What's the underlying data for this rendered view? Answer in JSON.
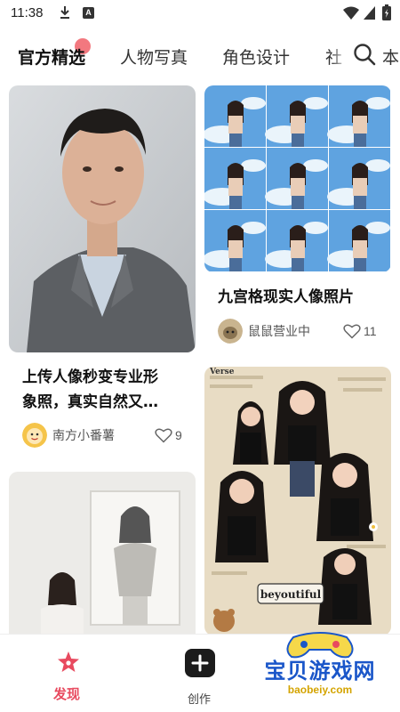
{
  "status_bar": {
    "time": "11:38",
    "icons": [
      "download-icon",
      "a-badge-icon",
      "wifi-icon",
      "cellular-icon",
      "battery-icon"
    ]
  },
  "tabs": [
    {
      "label": "官方精选",
      "active": true
    },
    {
      "label": "人物写真",
      "active": false
    },
    {
      "label": "角色设计",
      "active": false
    },
    {
      "label": "社",
      "active": false
    },
    {
      "label": "本",
      "active": false
    }
  ],
  "feed": {
    "cards": [
      {
        "title": "上传人像秒变专业形象照，真实自然又…",
        "title_line1": "上传人像秒变专业形",
        "title_line2": "象照，真实自然又…",
        "author": "南方小番薯",
        "likes": "9"
      },
      {
        "title": "九宫格现实人像照片",
        "author": "鼠鼠营业中",
        "likes": "11"
      },
      {
        "title": "",
        "author": "",
        "likes": ""
      },
      {
        "title": "",
        "author": "",
        "likes": ""
      }
    ],
    "collage_stickers": [
      "beyoutiful",
      "Verse"
    ]
  },
  "bottom_nav": {
    "discover_label": "发现",
    "create_label": "创作"
  },
  "watermark": {
    "text": "宝贝游戏网",
    "url": "baobeiy.com"
  },
  "colors": {
    "accent": "#e84a5f",
    "tab_dot": "#f06068",
    "watermark_blue": "#1a56c9"
  }
}
